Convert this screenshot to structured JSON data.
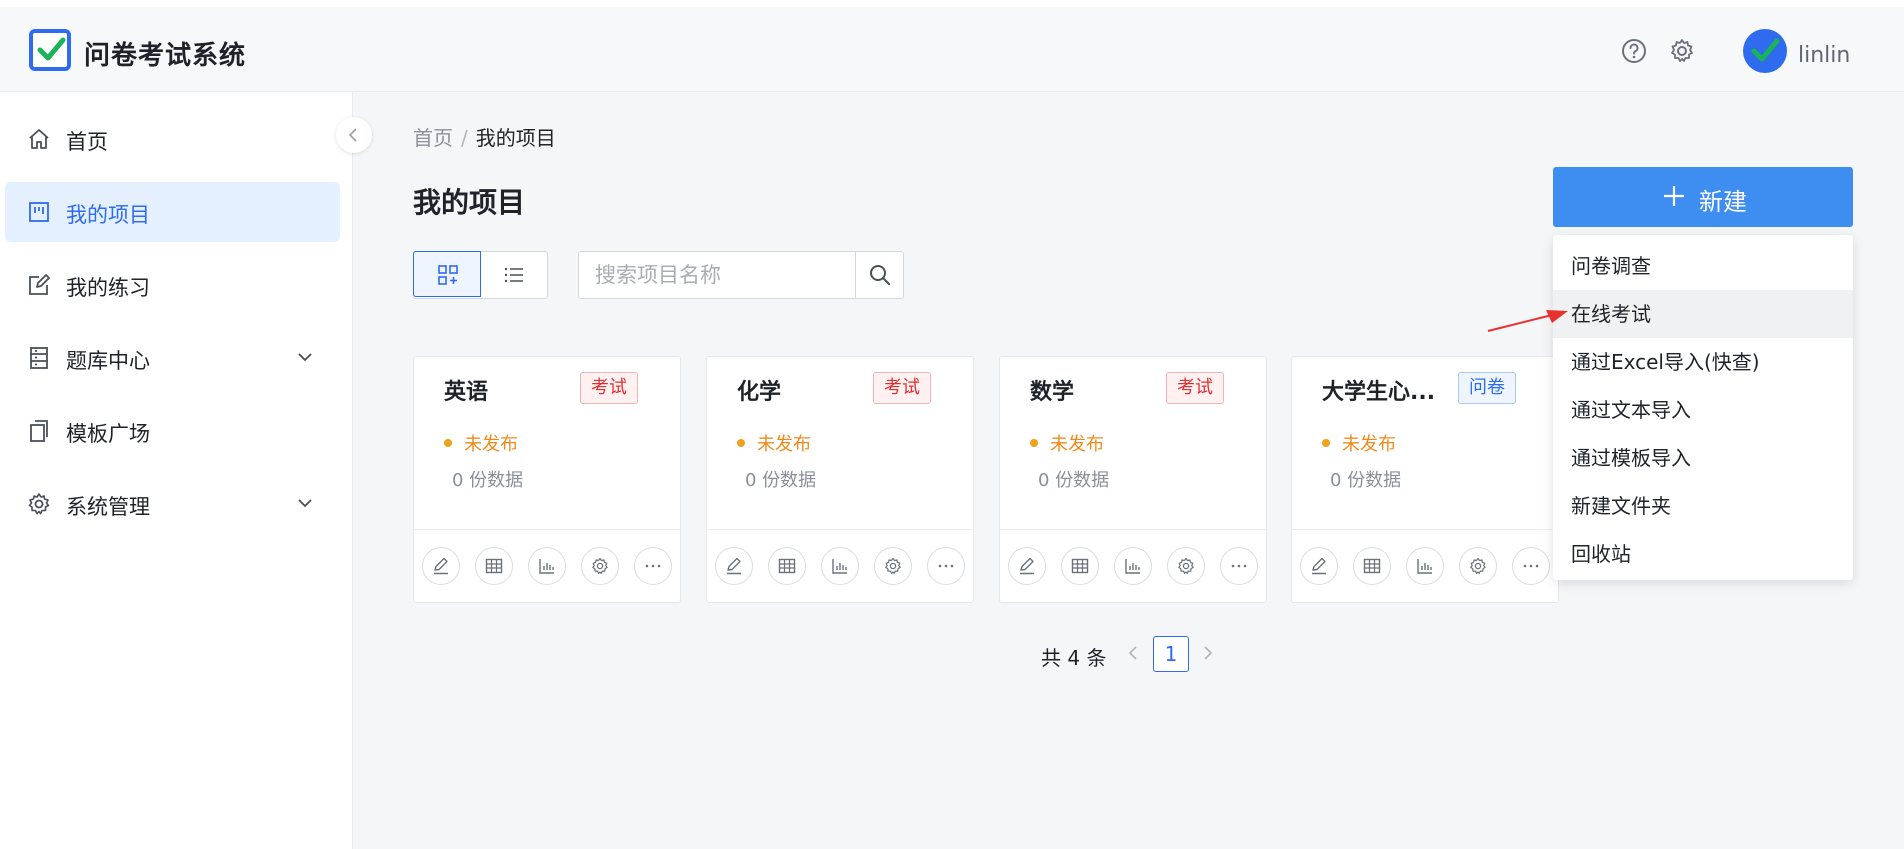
{
  "app": {
    "title": "问卷考试系统",
    "username": "linlin"
  },
  "sidebar": {
    "items": [
      {
        "label": "首页",
        "icon": "home-icon"
      },
      {
        "label": "我的项目",
        "icon": "board-icon",
        "active": true
      },
      {
        "label": "我的练习",
        "icon": "edit-icon"
      },
      {
        "label": "题库中心",
        "icon": "database-icon",
        "expandable": true
      },
      {
        "label": "模板广场",
        "icon": "copy-icon"
      },
      {
        "label": "系统管理",
        "icon": "gear-icon",
        "expandable": true
      }
    ]
  },
  "breadcrumb": {
    "home": "首页",
    "sep": "/",
    "current": "我的项目"
  },
  "page": {
    "title": "我的项目"
  },
  "toolbar": {
    "new_label": "新建",
    "search_placeholder": "搜索项目名称"
  },
  "cards": [
    {
      "title": "英语",
      "tag": "考试",
      "status": "未发布",
      "count": "0 份数据"
    },
    {
      "title": "化学",
      "tag": "考试",
      "status": "未发布",
      "count": "0 份数据"
    },
    {
      "title": "数学",
      "tag": "考试",
      "status": "未发布",
      "count": "0 份数据"
    },
    {
      "title": "大学生心...",
      "tag": "问卷",
      "status": "未发布",
      "count": "0 份数据"
    }
  ],
  "pagination": {
    "total": "共 4 条",
    "current": "1"
  },
  "dropdown": {
    "items": [
      "问卷调查",
      "在线考试",
      "通过Excel导入(快查)",
      "通过文本导入",
      "通过模板导入",
      "新建文件夹",
      "回收站"
    ],
    "hovered": "在线考试"
  },
  "colors": {
    "primary": "#2f6bef",
    "button": "#3d8ef0",
    "exam_tag": "#e02f2f",
    "survey_tag": "#2f6bef",
    "status": "#f08a1a"
  }
}
